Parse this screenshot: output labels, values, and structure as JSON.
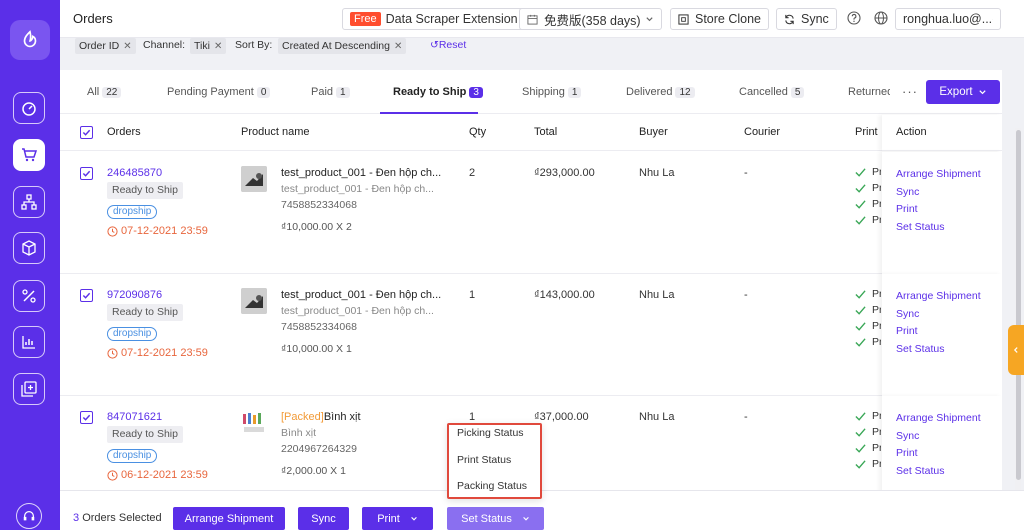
{
  "header": {
    "title": "Orders",
    "free_badge": "Free",
    "extension": "Data Scraper Extension",
    "plan": "免费版(358 days)",
    "store_clone": "Store Clone",
    "sync": "Sync",
    "user": "ronghua.luo@..."
  },
  "filters": {
    "order_id": "Order ID",
    "channel_label": "Channel:",
    "channel_value": "Tiki",
    "sort_label": "Sort By:",
    "sort_value": "Created At Descending",
    "reset": "Reset"
  },
  "tabs": [
    {
      "label": "All",
      "count": "22"
    },
    {
      "label": "Pending Payment",
      "count": "0"
    },
    {
      "label": "Paid",
      "count": "1"
    },
    {
      "label": "Ready to Ship",
      "count": "3"
    },
    {
      "label": "Shipping",
      "count": "1"
    },
    {
      "label": "Delivered",
      "count": "12"
    },
    {
      "label": "Cancelled",
      "count": "5"
    },
    {
      "label": "Returned",
      "count": ""
    }
  ],
  "more": "···",
  "export": "Export",
  "columns": {
    "orders": "Orders",
    "product": "Product name",
    "qty": "Qty",
    "total": "Total",
    "buyer": "Buyer",
    "courier": "Courier",
    "print": "Print",
    "action": "Action"
  },
  "rows": [
    {
      "order_id": "246485870",
      "status": "Ready to Ship",
      "tag": "dropship",
      "deadline": "07-12-2021 23:59",
      "packed": "",
      "product_name": "test_product_001 - Đen hộp ch...",
      "product_sub": "test_product_001 - Đen hộp ch...",
      "sku": "7458852334068",
      "price": "₫10,000.00 X 2",
      "qty": "2",
      "total": "₫293,000.00",
      "buyer": "Nhu La",
      "courier": "-"
    },
    {
      "order_id": "972090876",
      "status": "Ready to Ship",
      "tag": "dropship",
      "deadline": "07-12-2021 23:59",
      "packed": "",
      "product_name": "test_product_001 - Đen hộp ch...",
      "product_sub": "test_product_001 - Đen hộp ch...",
      "sku": "7458852334068",
      "price": "₫10,000.00 X 1",
      "qty": "1",
      "total": "₫143,000.00",
      "buyer": "Nhu La",
      "courier": "-"
    },
    {
      "order_id": "847071621",
      "status": "Ready to Ship",
      "tag": "dropship",
      "deadline": "06-12-2021 23:59",
      "packed": "[Packed]",
      "product_name": "Bình xịt",
      "product_sub": "Bình xịt",
      "sku": "2204967264329",
      "price": "₫2,000.00 X 1",
      "qty": "1",
      "total": "₫37,000.00",
      "buyer": "Nhu La",
      "courier": "-"
    }
  ],
  "print_status": "Pr",
  "actions": {
    "arrange": "Arrange Shipment",
    "sync": "Sync",
    "print": "Print",
    "set_status": "Set Status"
  },
  "bottom": {
    "selected_count": "3",
    "selected_text": "Orders Selected",
    "arrange": "Arrange Shipment",
    "sync": "Sync",
    "print": "Print",
    "set_status": "Set Status"
  },
  "dropdown": [
    "Picking Status",
    "Print Status",
    "Packing Status"
  ],
  "colors": {
    "brand": "#5b2fe8",
    "warning": "#e8663d",
    "highlight": "#e0493c"
  }
}
